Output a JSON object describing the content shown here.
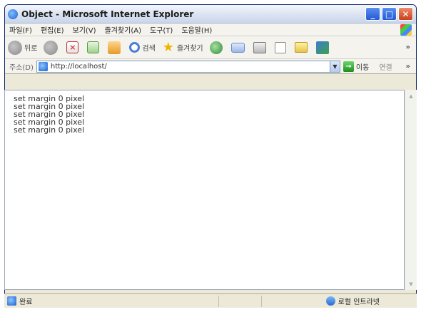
{
  "window": {
    "title": "Object - Microsoft Internet Explorer"
  },
  "menubar": {
    "items": [
      "파일(F)",
      "편집(E)",
      "보기(V)",
      "즐겨찾기(A)",
      "도구(T)",
      "도움말(H)"
    ]
  },
  "toolbar": {
    "back_label": "뒤로",
    "search_label": "검색",
    "favorites_label": "즐겨찾기"
  },
  "addressbar": {
    "label": "주소(D)",
    "url": "http://localhost/",
    "go_label": "이동",
    "links_label": "연결"
  },
  "content": {
    "lines": [
      "set margin 0 pixel",
      "set margin 0 pixel",
      "set margin 0 pixel",
      "set margin 0 pixel",
      "set margin 0 pixel"
    ]
  },
  "statusbar": {
    "status_text": "완료",
    "zone_text": "로컬 인트라넷"
  }
}
